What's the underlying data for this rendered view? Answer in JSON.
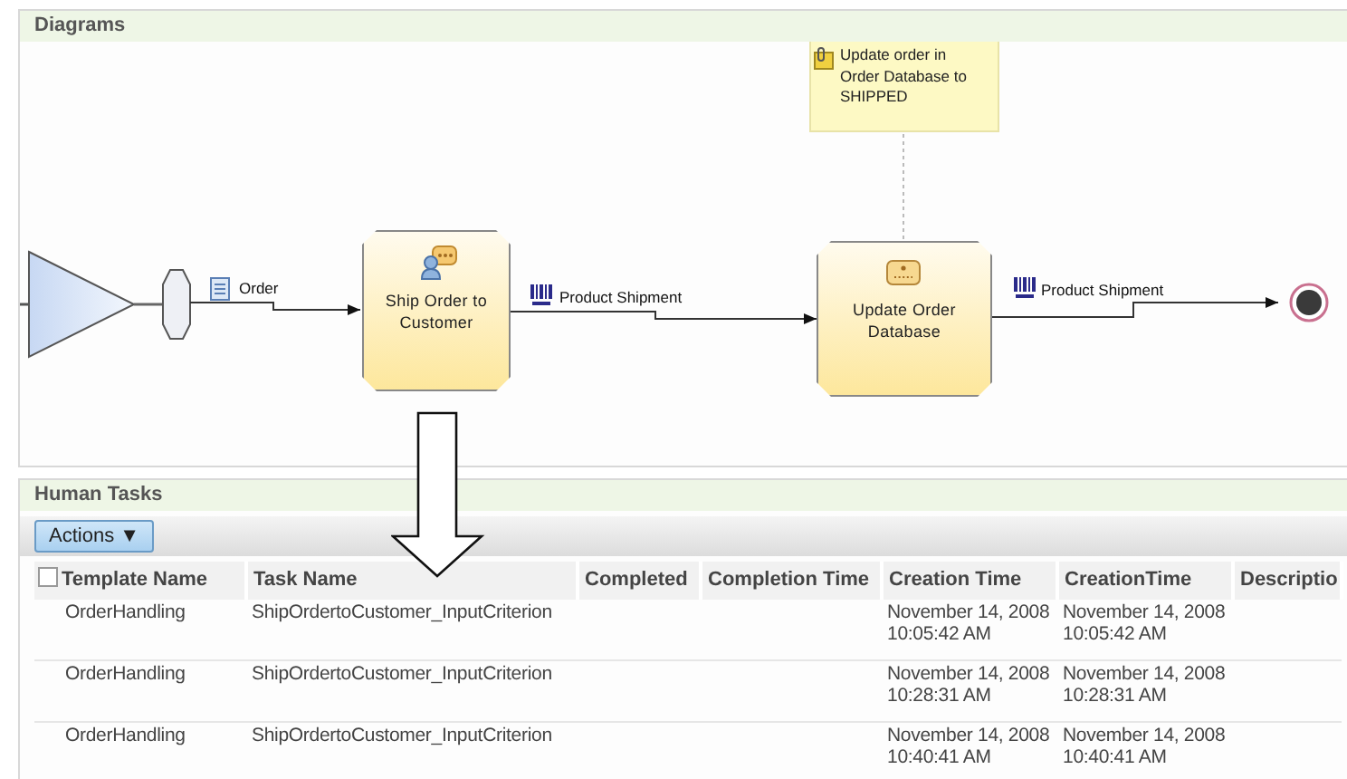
{
  "diagram": {
    "title": "Diagrams",
    "note": "Update order in Order Database to SHIPPED",
    "tasks": [
      {
        "label": "Ship Order to Customer",
        "kind": "human"
      },
      {
        "label": "Update Order Database",
        "kind": "service"
      }
    ],
    "connections": [
      {
        "label": "Order",
        "kind": "document"
      },
      {
        "label": "Product Shipment",
        "kind": "barcode"
      },
      {
        "label": "Product Shipment",
        "kind": "barcode"
      }
    ]
  },
  "human_tasks": {
    "title": "Human Tasks",
    "actions_button": "Actions ▼",
    "select_all": {
      "checked": false
    },
    "columns": [
      "Template Name",
      "Task Name",
      "Completed",
      "Completion Time",
      "Creation Time",
      "CreationTime",
      "Descriptio"
    ],
    "rows": [
      {
        "cells": [
          "OrderHandling",
          "ShipOrdertoCustomer_InputCriterion",
          "",
          "",
          "November 14, 2008 10:05:42 AM",
          "November 14, 2008 10:05:42 AM",
          ""
        ]
      },
      {
        "cells": [
          "OrderHandling",
          "ShipOrdertoCustomer_InputCriterion",
          "",
          "",
          "November 14, 2008 10:28:31 AM",
          "November 14, 2008 10:28:31 AM",
          ""
        ]
      },
      {
        "cells": [
          "OrderHandling",
          "ShipOrdertoCustomer_InputCriterion",
          "",
          "",
          "November 14, 2008 10:40:41 AM",
          "November 14, 2008 10:40:41 AM",
          ""
        ]
      }
    ]
  }
}
